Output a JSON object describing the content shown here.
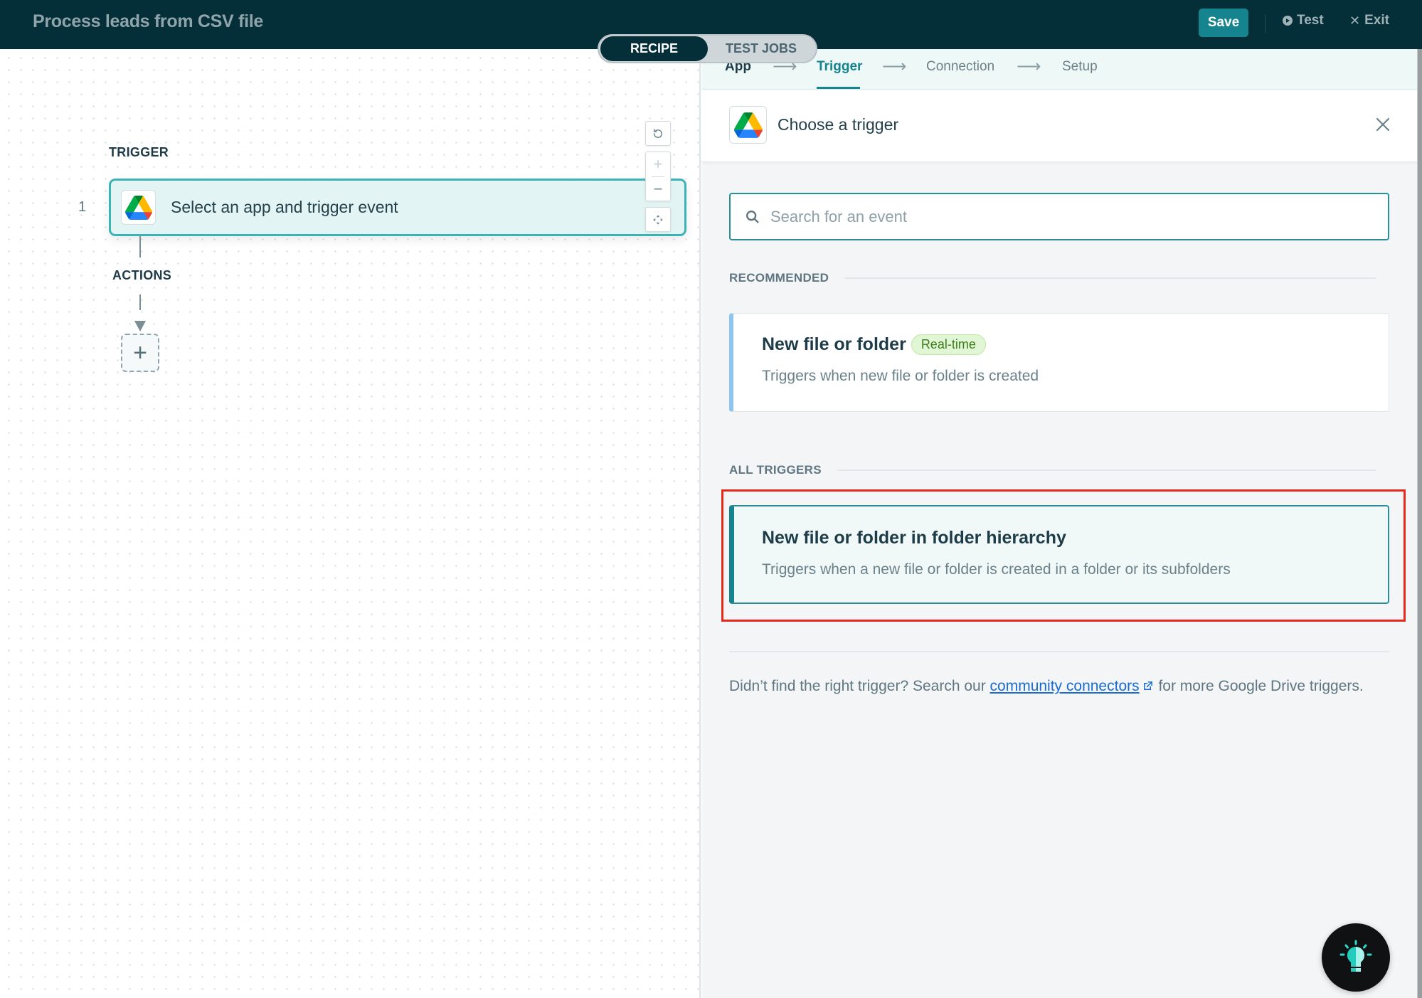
{
  "topbar": {
    "recipe_title": "Process leads from CSV file",
    "save_label": "Save",
    "test_label": "Test",
    "exit_label": "Exit"
  },
  "mode_toggle": {
    "tabs": [
      {
        "label": "RECIPE",
        "active": true
      },
      {
        "label": "TEST JOBS",
        "active": false
      }
    ]
  },
  "canvas": {
    "trigger_label": "TRIGGER",
    "step_number": "1",
    "trigger_card_text": "Select an app and trigger event",
    "actions_label": "ACTIONS",
    "add_action_symbol": "+",
    "zoom_controls": {
      "reset_icon": "reset-icon",
      "zoom_in_symbol": "+",
      "zoom_out_symbol": "−",
      "fit_icon": "fit-to-screen-icon"
    }
  },
  "wizard": {
    "steps": [
      {
        "label": "App",
        "state": "done"
      },
      {
        "label": "Trigger",
        "state": "active"
      },
      {
        "label": "Connection",
        "state": "pending"
      },
      {
        "label": "Setup",
        "state": "pending"
      }
    ],
    "arrow": "⟶"
  },
  "panel": {
    "title": "Choose a trigger",
    "app_icon": "google-drive-icon",
    "search": {
      "value": "",
      "placeholder": "Search for an event"
    },
    "recommended_heading": "RECOMMENDED",
    "recommended": [
      {
        "title": "New file or folder",
        "badge": "Real-time",
        "description": "Triggers when new file or folder is created"
      }
    ],
    "all_heading": "ALL TRIGGERS",
    "all_triggers": [
      {
        "title": "New file or folder in folder hierarchy",
        "description": "Triggers when a new file or folder is created in a folder or its subfolders",
        "selected": true
      }
    ],
    "footer": {
      "before_link": "Didn’t find the right trigger? Search our ",
      "link_text": "community connectors",
      "after_link": " for more Google Drive triggers."
    }
  },
  "colors": {
    "topbar_bg": "#052f38",
    "accent": "#16848f",
    "highlight": "#e7281d",
    "badge_bg": "#e1f6d4",
    "badge_text": "#3d7a1e",
    "link": "#1a6bd2"
  }
}
